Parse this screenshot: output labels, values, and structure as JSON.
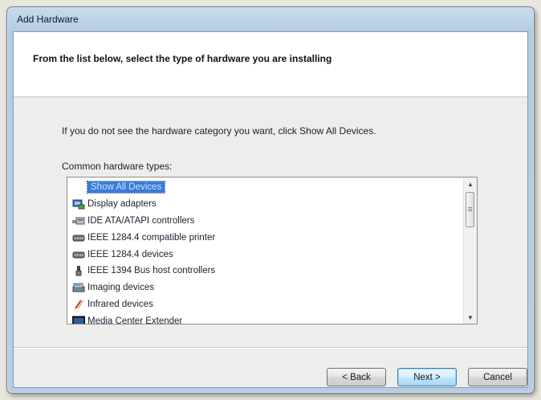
{
  "window": {
    "title": "Add Hardware"
  },
  "header": {
    "title": "From the list below, select the type of hardware you are installing"
  },
  "body": {
    "instruction": "If you do not see the hardware category you want, click Show All Devices.",
    "list_label": "Common hardware types:"
  },
  "hardware_list": {
    "selected_index": 0,
    "items": [
      {
        "label": "Show All Devices",
        "icon": "none"
      },
      {
        "label": "Display adapters",
        "icon": "display-adapter-icon"
      },
      {
        "label": "IDE ATA/ATAPI controllers",
        "icon": "ide-controller-icon"
      },
      {
        "label": "IEEE 1284.4 compatible printer",
        "icon": "printer-port-icon"
      },
      {
        "label": "IEEE 1284.4 devices",
        "icon": "printer-port-icon"
      },
      {
        "label": "IEEE 1394 Bus host controllers",
        "icon": "firewire-icon"
      },
      {
        "label": "Imaging devices",
        "icon": "imaging-device-icon"
      },
      {
        "label": "Infrared devices",
        "icon": "infrared-icon"
      },
      {
        "label": "Media Center Extender",
        "icon": "media-center-icon"
      }
    ]
  },
  "buttons": {
    "back": "< Back",
    "next": "Next >",
    "cancel": "Cancel"
  },
  "colors": {
    "selection": "#3b7bd8",
    "title_bar": "#c8dcef"
  }
}
